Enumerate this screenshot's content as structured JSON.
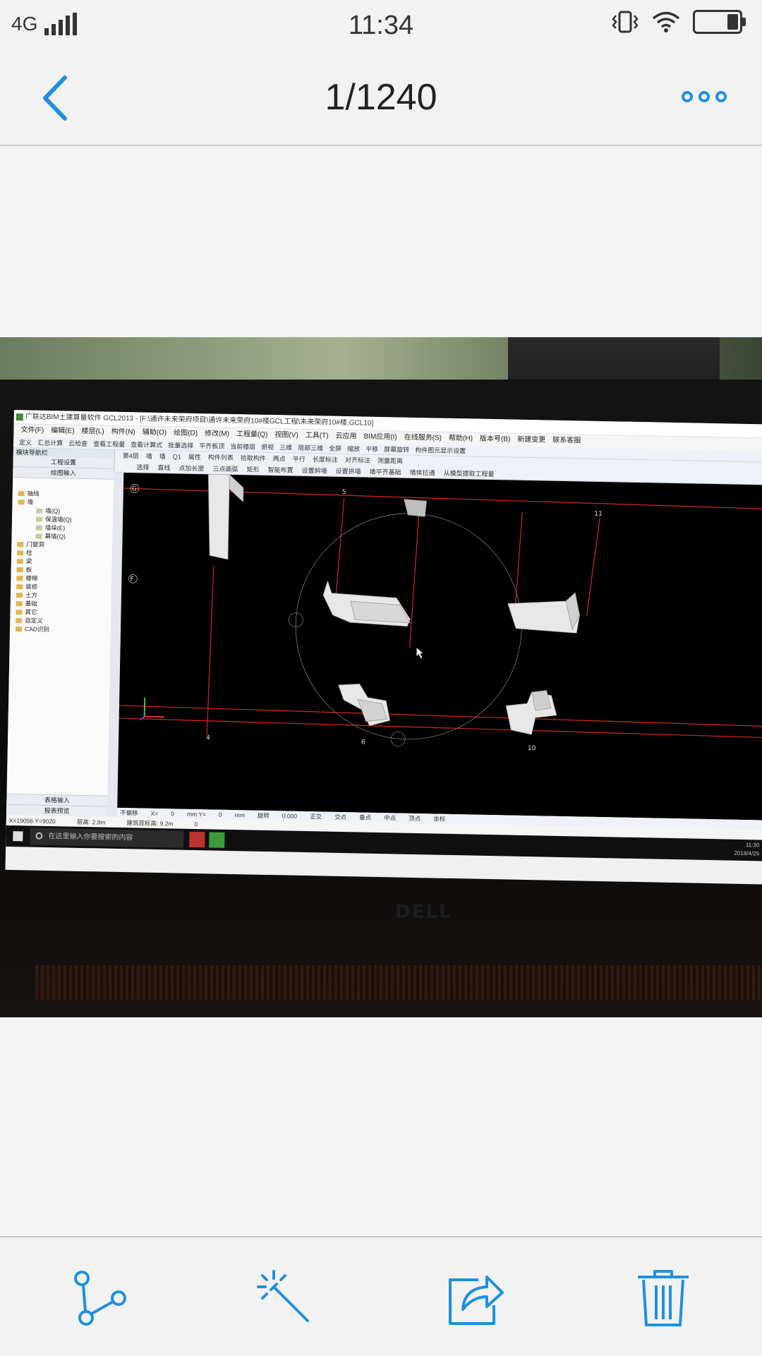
{
  "status_bar": {
    "network": "4G",
    "time": "11:34"
  },
  "header": {
    "page_counter": "1/1240"
  },
  "icons": {
    "back": "chevron-left-icon",
    "more": "more-dots-icon",
    "share": "share-nodes-icon",
    "edit": "magic-wand-icon",
    "export": "share-arrow-icon",
    "delete": "trash-icon"
  },
  "colors": {
    "accent": "#1e90e0",
    "cad_grid_line": "#d4281e"
  },
  "photo": {
    "brand": "DELL",
    "screen": {
      "title": "广联达BIM土建算量软件 GCL2013 - [F:\\通许未来荣府项目\\通许未来荣府10#楼GCL工程\\未来荣府10#楼.GCL10]",
      "menu": [
        "文件(F)",
        "编辑(E)",
        "楼层(L)",
        "构件(N)",
        "辅助(O)",
        "绘图(D)",
        "修改(M)",
        "工程量(Q)",
        "视图(V)",
        "工具(T)",
        "云应用",
        "BIM应用(I)",
        "在线服务(S)",
        "帮助(H)",
        "版本号(B)",
        "新建变更",
        "联系客服"
      ],
      "toolbar": [
        "定义",
        "汇总计算",
        "云检查",
        "查看工程量",
        "查看计算式",
        "批量选择",
        "平齐板顶",
        "当前楼层",
        "俯视",
        "三维",
        "局部三维",
        "全屏",
        "缩放",
        "平移",
        "屏幕旋转",
        "构件图元显示设置"
      ],
      "toolbar2": [
        "第4层",
        "墙",
        "墙",
        "Q1",
        "属性",
        "构件列表",
        "拾取构件",
        "两点",
        "平行",
        "长度标注",
        "对齐标注",
        "测量距离"
      ],
      "toolbar3": [
        "选择",
        "直线",
        "点加长度",
        "三点画弧",
        "矩形",
        "智能布置",
        "设置斜墙",
        "设置拱墙",
        "墙平齐基础",
        "墙体拉通",
        "从模型提取工程量"
      ],
      "nav_title": "模块导航栏",
      "nav_buttons": [
        "工程设置",
        "绘图输入"
      ],
      "nav_tree": [
        {
          "label": "轴线",
          "sub": false
        },
        {
          "label": "墙",
          "sub": false
        },
        {
          "label": "墙(Q)",
          "sub": true
        },
        {
          "label": "保温墙(Q)",
          "sub": true
        },
        {
          "label": "墙垛(E)",
          "sub": true
        },
        {
          "label": "幕墙(Q)",
          "sub": true
        },
        {
          "label": "门窗洞",
          "sub": false
        },
        {
          "label": "柱",
          "sub": false
        },
        {
          "label": "梁",
          "sub": false
        },
        {
          "label": "板",
          "sub": false
        },
        {
          "label": "楼梯",
          "sub": false
        },
        {
          "label": "装修",
          "sub": false
        },
        {
          "label": "土方",
          "sub": false
        },
        {
          "label": "基础",
          "sub": false
        },
        {
          "label": "其它",
          "sub": false
        },
        {
          "label": "自定义",
          "sub": false
        },
        {
          "label": "CAD识别",
          "sub": false
        }
      ],
      "nav_bottom": [
        "表格输入",
        "报表预览"
      ],
      "axis_labels": {
        "g": "G",
        "f": "F",
        "a4": "4",
        "a5": "5",
        "a6": "6",
        "a10": "10",
        "a11": "11"
      },
      "status": [
        "不偏移",
        "X=",
        "0",
        "mm Y=",
        "0",
        "mm",
        "旋转",
        "0.000",
        "正交",
        "交点",
        "垂点",
        "中点",
        "顶点",
        "坐标"
      ],
      "status2": [
        "X=19056 Y=9020",
        "层高: 2.9m",
        "建筑底标高: 9.2m",
        "0"
      ],
      "taskbar_search": "在这里输入你要搜索的内容",
      "taskbar_time": "11:30",
      "taskbar_date": "2018/4/25"
    }
  }
}
